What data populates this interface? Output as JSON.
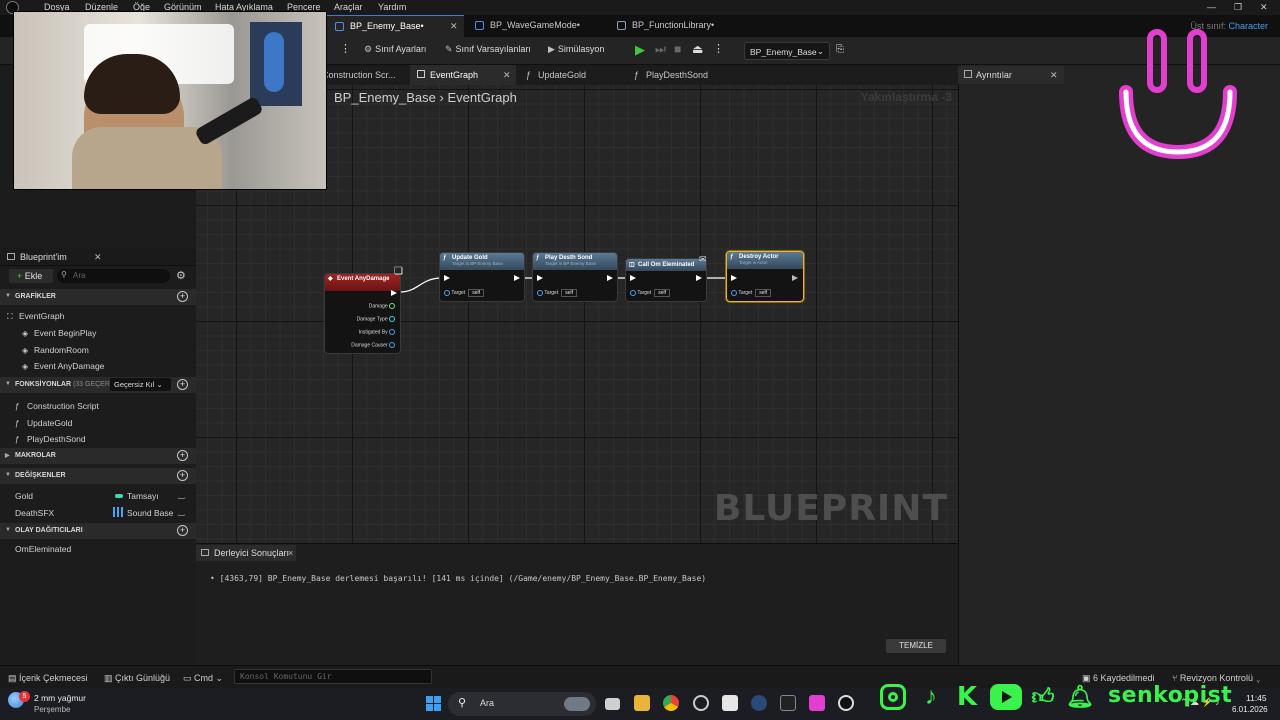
{
  "menu": [
    "Dosya",
    "Düzenle",
    "Öğe",
    "Görünüm",
    "Hata Ayıklama",
    "Pencere",
    "Araçlar",
    "Yardım"
  ],
  "document_tabs": [
    {
      "label": "BP_Enemy_Base•",
      "active": true
    },
    {
      "label": "BP_WaveGameMode•",
      "active": false
    },
    {
      "label": "BP_FunctionLibrary•",
      "active": false
    }
  ],
  "parent_class": {
    "label": "Üst sınıf:",
    "value": "Character"
  },
  "toolbar": {
    "class_settings": "Sınıf Ayarları",
    "class_defaults": "Sınıf Varsayılanları",
    "simulation": "Simülasyon",
    "debug_object": "BP_Enemy_Base"
  },
  "graph_tabs": [
    "Construction Scr...",
    "EventGraph",
    "UpdateGold",
    "PlayDesthSond"
  ],
  "graph": {
    "breadcrumb_parent": "BP_Enemy_Base",
    "breadcrumb_current": "EventGraph",
    "zoom": "Yakınlaştırma -3",
    "watermark": "BLUEPRINT"
  },
  "nodes": {
    "event_any_damage": {
      "title": "Event AnyDamage",
      "pins": [
        "Damage",
        "Damage Type",
        "Instigated By",
        "Damage Causer"
      ]
    },
    "update_gold": {
      "title": "Update Gold",
      "subtitle": "Target is BP Enemy Base",
      "target": "Target",
      "self": "self"
    },
    "play_death_sound": {
      "title": "Play Desth Sond",
      "subtitle": "Target is BP Enemy Base",
      "target": "Target",
      "self": "self"
    },
    "call_on_eliminated": {
      "title": "Call Om Eleminated",
      "target": "Target",
      "self": "self"
    },
    "destroy_actor": {
      "title": "Destroy Actor",
      "subtitle": "Target is Actor",
      "target": "Target",
      "self": "self"
    }
  },
  "my_blueprint": {
    "tab_label": "Blueprint'im",
    "add_label": "Ekle",
    "search_placeholder": "Ara",
    "graphs_header": "GRAFİKLER",
    "graphs": [
      "EventGraph",
      "Event BeginPlay",
      "RandomRoom",
      "Event AnyDamage"
    ],
    "functions_header": "FONKSİYONLAR",
    "functions_count": "(33 GEÇERSİ",
    "override_label": "Geçersiz Kıl",
    "functions": [
      "Construction Script",
      "UpdateGold",
      "PlayDesthSond"
    ],
    "macros_header": "MAKROLAR",
    "variables_header": "DEĞİŞKENLER",
    "variables": [
      {
        "name": "Gold",
        "type": "Tamsayı",
        "type_color": "#3fd7b4"
      },
      {
        "name": "DeathSFX",
        "type": "Sound Base",
        "type_color": "#4aa6f0"
      }
    ],
    "dispatchers_header": "OLAY DAĞITICILARI",
    "dispatchers": [
      "OmEleminated"
    ]
  },
  "details": {
    "tab_label": "Ayrıntılar"
  },
  "compiler": {
    "tab_label": "Derleyici Sonuçları",
    "message": "[4363,79] BP_Enemy_Base derlemesi başarılı! [141 ms içinde] (/Game/enemy/BP_Enemy_Base.BP_Enemy_Base)",
    "clear_label": "TEMİZLE"
  },
  "statusbar": {
    "content_drawer": "İçerik Çekmecesi",
    "output_log": "Çıktı Günlüğü",
    "cmd": "Cmd",
    "console_placeholder": "Konsol Komutunu Gir",
    "saved": "6 Kaydedilmedi",
    "revision_control": "Revizyon Kontrolü"
  },
  "taskbar": {
    "weather_temp": "2 mm yağmur",
    "weather_day": "Perşembe",
    "weather_badge": "5",
    "search": "Ara",
    "time": "11:45",
    "date": "6.01.2026"
  },
  "overlay": {
    "brand": "senkopist"
  },
  "colors": {
    "accent": "#3a7cd8",
    "brand_green": "#3bf24c",
    "face_pink": "#e23fcf",
    "selected_outline": "#f0b21e"
  }
}
